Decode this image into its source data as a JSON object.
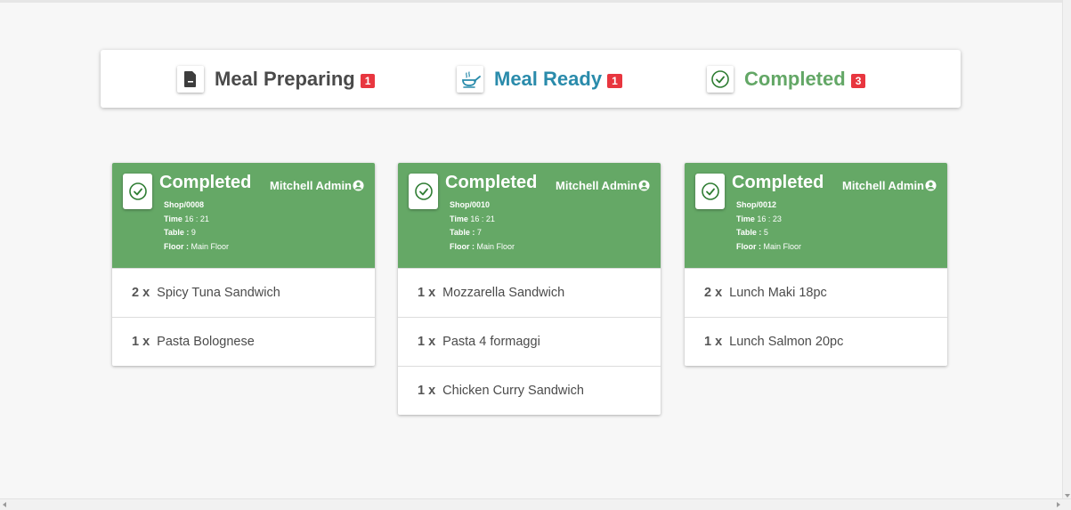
{
  "tabs": [
    {
      "label": "Meal Preparing",
      "count": "1",
      "icon": "document-icon",
      "color": "#4a4a4a"
    },
    {
      "label": "Meal Ready",
      "count": "1",
      "icon": "serving-pan-icon",
      "color": "#2a8bab"
    },
    {
      "label": "Completed",
      "count": "3",
      "icon": "check-circle-icon",
      "color": "#63a766"
    }
  ],
  "colors": {
    "card_header": "#65a866",
    "badge": "#e8363f"
  },
  "orders": [
    {
      "state": "Completed",
      "user": "Mitchell Admin",
      "ref": "Shop/0008",
      "time_label": "Time",
      "time": "16 : 21",
      "table_label": "Table :",
      "table": "9",
      "floor_label": "Floor :",
      "floor": "Main Floor",
      "lines": [
        {
          "qty": "2 x",
          "name": "Spicy Tuna Sandwich"
        },
        {
          "qty": "1 x",
          "name": "Pasta Bolognese"
        }
      ]
    },
    {
      "state": "Completed",
      "user": "Mitchell Admin",
      "ref": "Shop/0010",
      "time_label": "Time",
      "time": "16 : 21",
      "table_label": "Table :",
      "table": "7",
      "floor_label": "Floor :",
      "floor": "Main Floor",
      "lines": [
        {
          "qty": "1 x",
          "name": "Mozzarella Sandwich"
        },
        {
          "qty": "1 x",
          "name": "Pasta 4 formaggi"
        },
        {
          "qty": "1 x",
          "name": "Chicken Curry Sandwich"
        }
      ]
    },
    {
      "state": "Completed",
      "user": "Mitchell Admin",
      "ref": "Shop/0012",
      "time_label": "Time",
      "time": "16 : 23",
      "table_label": "Table :",
      "table": "5",
      "floor_label": "Floor :",
      "floor": "Main Floor",
      "lines": [
        {
          "qty": "2 x",
          "name": "Lunch Maki 18pc"
        },
        {
          "qty": "1 x",
          "name": "Lunch Salmon 20pc"
        }
      ]
    }
  ]
}
